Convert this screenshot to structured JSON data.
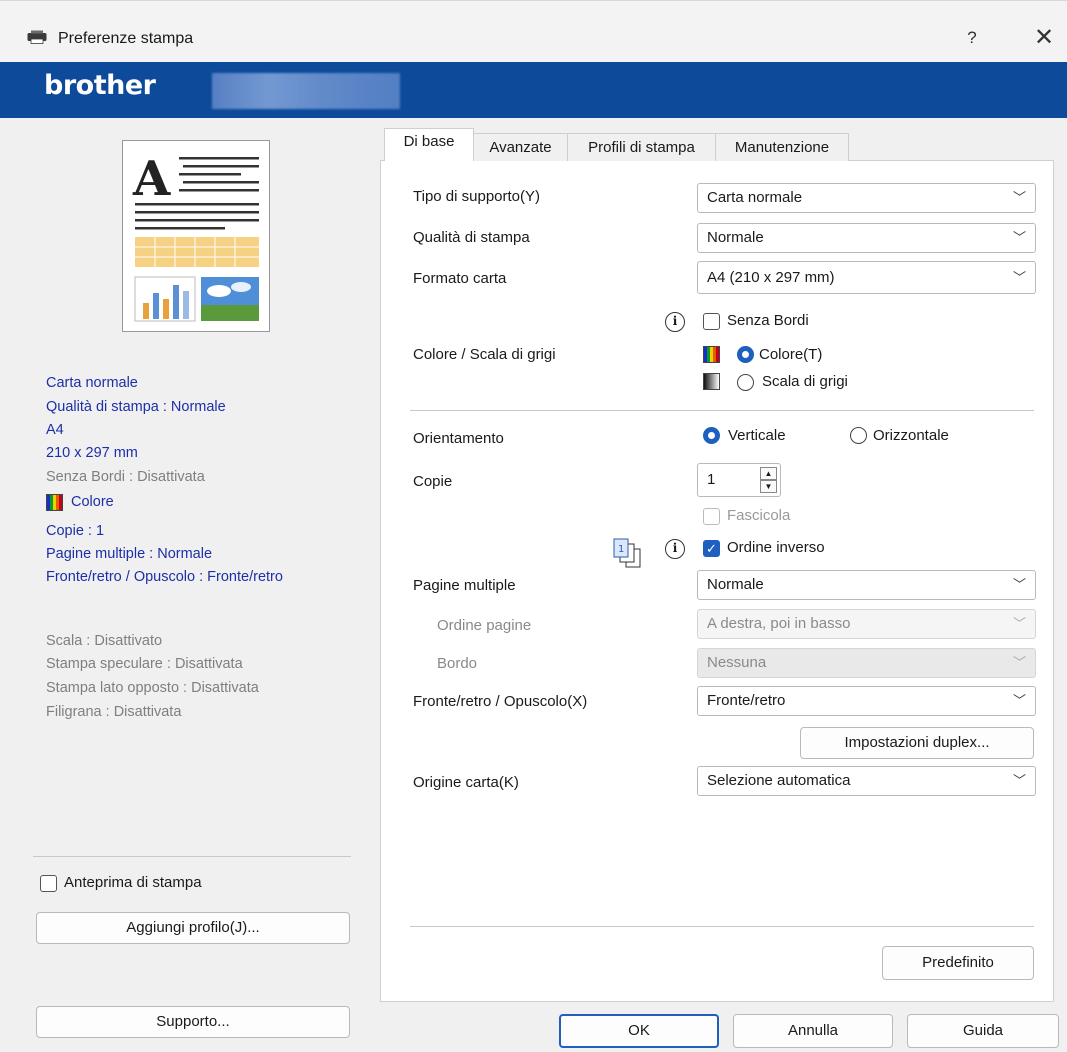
{
  "window": {
    "title": "Preferenze stampa",
    "help": "?",
    "close": "✕"
  },
  "brand": {
    "logo": "brother"
  },
  "summary": {
    "media": "Carta normale",
    "quality": "Qualità di stampa : Normale",
    "paper": "A4",
    "paper_dims": "210 x 297 mm",
    "borderless": "Senza Bordi : Disattivata",
    "color": "Colore",
    "copies": "Copie : 1",
    "multipage": "Pagine multiple : Normale",
    "duplex": "Fronte/retro / Opuscolo : Fronte/retro",
    "scale": "Scala : Disattivato",
    "mirror": "Stampa speculare : Disattivata",
    "reverse_side": "Stampa lato opposto : Disattivata",
    "watermark": "Filigrana : Disattivata"
  },
  "left": {
    "print_preview": "Anteprima di stampa",
    "add_profile": "Aggiungi profilo(J)...",
    "support": "Supporto..."
  },
  "tabs": [
    {
      "label": "Di base"
    },
    {
      "label": "Avanzate"
    },
    {
      "label": "Profili di stampa"
    },
    {
      "label": "Manutenzione"
    }
  ],
  "basic": {
    "media_type_label": "Tipo di supporto(Y)",
    "media_type_value": "Carta normale",
    "quality_label": "Qualità di stampa",
    "quality_value": "Normale",
    "paper_size_label": "Formato carta",
    "paper_size_value": "A4 (210 x 297 mm)",
    "borderless_label": "Senza Bordi",
    "color_label": "Colore / Scala di grigi",
    "color_option": "Colore(T)",
    "grayscale_option": "Scala di grigi",
    "orientation_label": "Orientamento",
    "portrait": "Verticale",
    "landscape": "Orizzontale",
    "copies_label": "Copie",
    "copies_value": "1",
    "collate": "Fascicola",
    "reverse_order": "Ordine inverso",
    "multipage_label": "Pagine multiple",
    "multipage_value": "Normale",
    "page_order_label": "Ordine pagine",
    "page_order_value": "A destra, poi in basso",
    "border_label": "Bordo",
    "border_value": "Nessuna",
    "duplex_label": "Fronte/retro / Opuscolo(X)",
    "duplex_value": "Fronte/retro",
    "duplex_settings": "Impostazioni duplex...",
    "paper_source_label": "Origine carta(K)",
    "paper_source_value": "Selezione automatica",
    "default_button": "Predefinito"
  },
  "footer": {
    "ok": "OK",
    "cancel": "Annulla",
    "help": "Guida"
  },
  "colors": {
    "brand_bar": "#0d4a99",
    "accent": "#1f5fbf",
    "summary_text": "#1d2fa8"
  }
}
